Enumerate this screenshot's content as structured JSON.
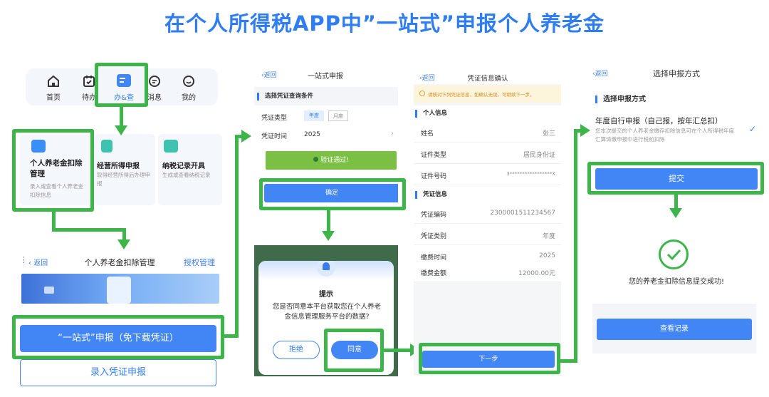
{
  "page": {
    "title": "在个人所得税APP中”一站式”申报个人养老金"
  },
  "p1": {
    "nav": [
      {
        "label": "首页",
        "icon": "home-icon"
      },
      {
        "label": "待办",
        "icon": "calendar-check-icon"
      },
      {
        "label": "办&查",
        "icon": "service-icon"
      },
      {
        "label": "消息",
        "icon": "message-icon"
      },
      {
        "label": "我的",
        "icon": "smile-icon"
      }
    ],
    "cards": [
      {
        "title": "个人养老金扣除管理",
        "desc": "录入或查看个人养老金扣除信息",
        "icon": "pension-icon"
      },
      {
        "title": "经营所得申报",
        "desc": "取得经营所得后办理申报",
        "icon": "business-icon"
      },
      {
        "title": "纳税记录开具",
        "desc": "生成或查看纳税记录",
        "icon": "record-icon"
      }
    ],
    "header": {
      "back": "返回",
      "title": "个人养老金扣除管理",
      "auth": "授权管理"
    },
    "btn_one_stop": "“一站式”申报（免下载凭证）",
    "btn_manual": "录入凭证申报"
  },
  "p2": {
    "back": "返回",
    "title": "一站式申报",
    "section": "选择凭证查询条件",
    "type_label": "凭证类型",
    "type_opts": [
      "年度",
      "月度"
    ],
    "time_label": "凭证时间",
    "time_value": "2025",
    "verified": "验证通过!",
    "confirm": "确定",
    "dialog": {
      "title": "提示",
      "body": "您是否同意本平台获取您在个人养老金信息管理服务平台的数据?",
      "reject": "拒绝",
      "agree": "同意"
    }
  },
  "p3": {
    "back": "返回",
    "title": "凭证信息确认",
    "notice": "请核对下列凭证信息，如确认无误，可继续下一步。",
    "personal_section": "个人信息",
    "personal": [
      {
        "k": "姓名",
        "v": "张三"
      },
      {
        "k": "证件类型",
        "v": "居民身份证"
      },
      {
        "k": "证件号码",
        "v": "3*****************X"
      }
    ],
    "voucher_section": "凭证信息",
    "voucher": [
      {
        "k": "凭证编码",
        "v": "2300001511234567"
      },
      {
        "k": "凭证类别",
        "v": "年度"
      },
      {
        "k": "缴费时间",
        "v": "2025"
      },
      {
        "k": "缴费金额",
        "v": "12000.00元"
      }
    ],
    "next": "下一步"
  },
  "p4": {
    "back": "返回",
    "title": "选择申报方式",
    "section": "选择申报方式",
    "option_title": "年度自行申报（自己报，按年汇总扣）",
    "option_desc": "您本次提交的个人养老金缴存扣除信息可在个人所得税年度汇算清缴申报中进行税前扣除",
    "submit": "提交",
    "success": "您的养老金扣除信息提交成功!",
    "view": "查看记录"
  },
  "colors": {
    "accent": "#2f7df2",
    "green": "#3db54a",
    "button": "#4285f4"
  }
}
